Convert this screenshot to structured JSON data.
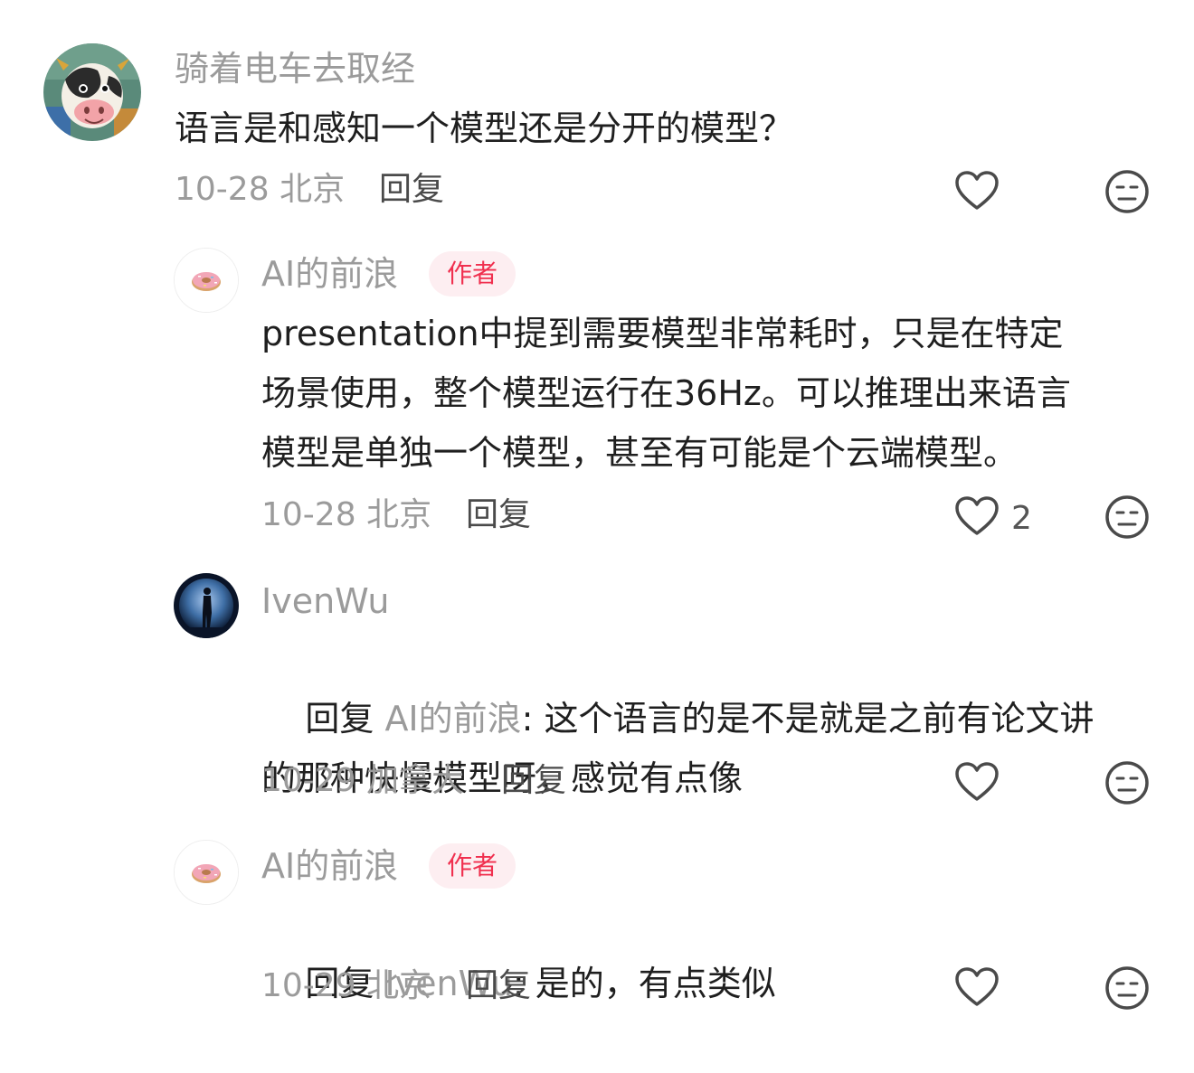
{
  "comments": [
    {
      "username": "骑着电车去取经",
      "is_author": false,
      "text": "语言是和感知一个模型还是分开的模型？",
      "date": "10-28",
      "location": "北京",
      "reply_label": "回复",
      "like_count": "",
      "avatar": "cow-avatar"
    },
    {
      "username": "AI的前浪",
      "is_author": true,
      "author_badge": "作者",
      "text": "presentation中提到需要模型非常耗时，只是在特定\n场景使用，整个模型运行在36Hz。可以推理出来语言\n模型是单独一个模型，甚至有可能是个云端模型。",
      "date": "10-28",
      "location": "北京",
      "reply_label": "回复",
      "like_count": "2",
      "avatar": "donut-avatar"
    },
    {
      "username": "IvenWu",
      "is_author": false,
      "reply_prefix": "回复",
      "reply_to": "AI的前浪",
      "text": ": 这个语言的是不是就是之前有论文讲\n的那种快慢模型呀，感觉有点像",
      "date": "10-29",
      "location": "加拿大",
      "reply_label": "回复",
      "like_count": "",
      "avatar": "silhouette-avatar"
    },
    {
      "username": "AI的前浪",
      "is_author": true,
      "author_badge": "作者",
      "reply_prefix": "回复",
      "reply_to": "IvenWu",
      "text": ": 是的，有点类似",
      "date": "10-29",
      "location": "北京",
      "reply_label": "回复",
      "like_count": "",
      "avatar": "donut-avatar"
    }
  ],
  "colors": {
    "username": "#9b9b9b",
    "text": "#1f1f1f",
    "badge_text": "#f0304f",
    "badge_bg": "#fdeef1",
    "icon": "#4a4a4a"
  }
}
